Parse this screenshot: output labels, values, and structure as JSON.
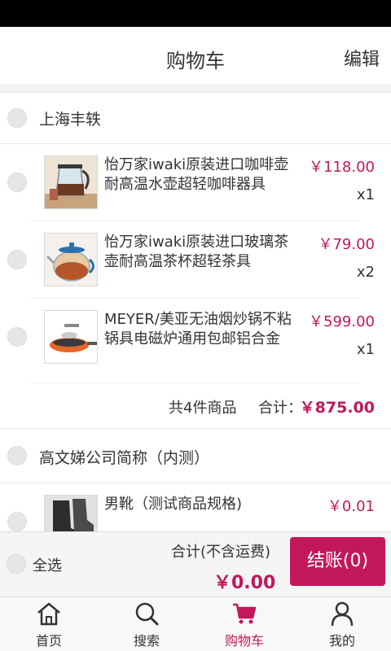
{
  "header": {
    "title": "购物车",
    "edit_label": "编辑"
  },
  "stores": [
    {
      "name": "上海丰轶",
      "items": [
        {
          "title": "怡万家iwaki原装进口咖啡壶耐高温水壶超轻咖啡器具",
          "price": "￥118.00",
          "qty": "x1",
          "thumb": "coffee-pot"
        },
        {
          "title": "怡万家iwaki原装进口玻璃茶壶耐高温茶杯超轻茶具",
          "price": "￥79.00",
          "qty": "x2",
          "thumb": "teapot"
        },
        {
          "title": "MEYER/美亚无油烟炒锅不粘锅具电磁炉通用包邮铝合金",
          "price": "￥599.00",
          "qty": "x1",
          "thumb": "wok"
        }
      ],
      "summary": {
        "count": "共4件商品",
        "total_label": "合计：",
        "total": "￥875.00"
      }
    },
    {
      "name": "高文娣公司简称（内测）",
      "items": [
        {
          "title": "男靴（测试商品规格)",
          "price": "￥0.01",
          "qty": "",
          "thumb": "boots"
        }
      ]
    }
  ],
  "footer": {
    "select_all": "全选",
    "total_label": "合计(不含运费)",
    "total": "￥0.00",
    "checkout": "结账(0)"
  },
  "tabs": [
    {
      "label": "首页",
      "icon": "home-icon",
      "active": false
    },
    {
      "label": "搜索",
      "icon": "search-icon",
      "active": false
    },
    {
      "label": "购物车",
      "icon": "cart-icon",
      "active": true
    },
    {
      "label": "我的",
      "icon": "user-icon",
      "active": false
    }
  ],
  "colors": {
    "accent": "#c2185b"
  }
}
